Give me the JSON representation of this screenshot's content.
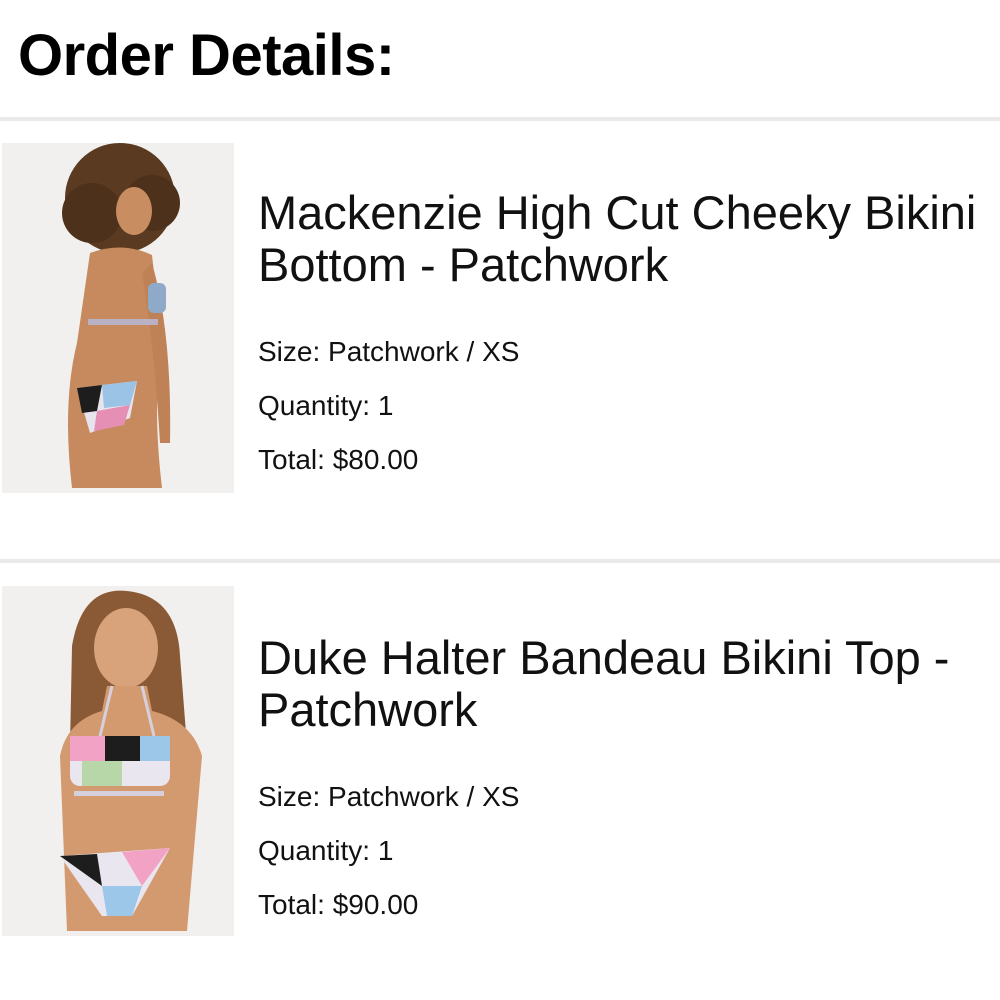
{
  "header": {
    "title": "Order Details:"
  },
  "items": [
    {
      "name": "Mackenzie High Cut Cheeky Bikini Bottom - Patchwork",
      "size": "Size: Patchwork / XS",
      "quantity": "Quantity: 1",
      "total": "Total: $80.00"
    },
    {
      "name": "Duke Halter Bandeau Bikini Top - Patchwork",
      "size": "Size: Patchwork / XS",
      "quantity": "Quantity: 1",
      "total": "Total: $90.00"
    }
  ],
  "colors": {
    "divider": "#e9e9e9",
    "text": "#111111",
    "thumb_bg": "#f1f0ee"
  }
}
